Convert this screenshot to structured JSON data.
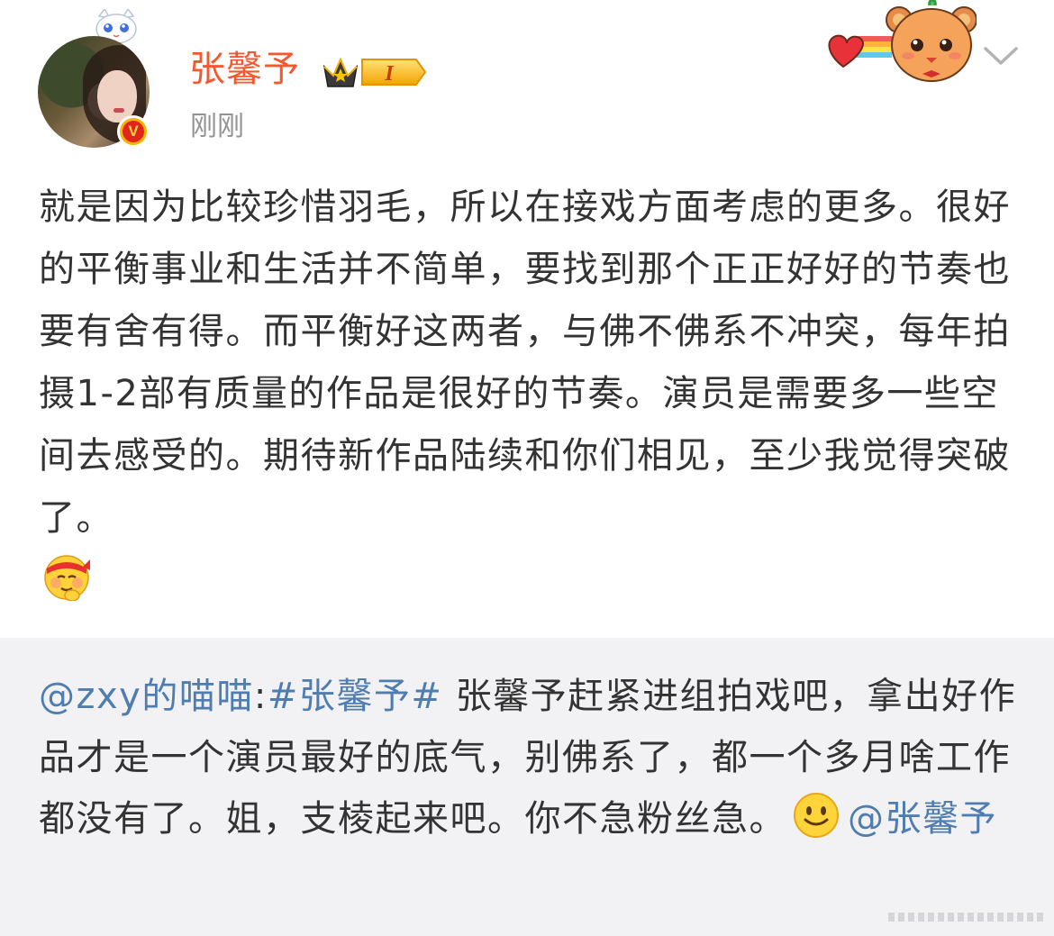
{
  "post": {
    "author": "张馨予",
    "time": "刚刚",
    "level_badge": "I",
    "verified_mark": "V",
    "body": "就是因为比较珍惜羽毛，所以在接戏方面考虑的更多。很好的平衡事业和生活并不简单，要找到那个正正好好的节奏也要有舍有得。而平衡好这两者，与佛不佛系不冲突，每年拍摄1-2部有质量的作品是很好的节奏。演员是需要多一些空间去感受的。期待新作品陆续和你们相见，至少我觉得突破了。",
    "emoji_after": "hardworking-emoji"
  },
  "repost": {
    "user_link": "@zxy的喵喵",
    "separator": ":",
    "topic": "#张馨予#",
    "text": " 张馨予赶紧进组拍戏吧，拿出好作品才是一个演员最好的底气，别佛系了，都一个多月啥工作都没有了。姐，支棱起来吧。你不急粉丝急。",
    "mention": "@张馨予",
    "emoji": "smile-emoji"
  },
  "colors": {
    "author_name": "#f3592f",
    "link": "#507daf",
    "repost_background": "#f2f2f5",
    "time": "#939393"
  }
}
